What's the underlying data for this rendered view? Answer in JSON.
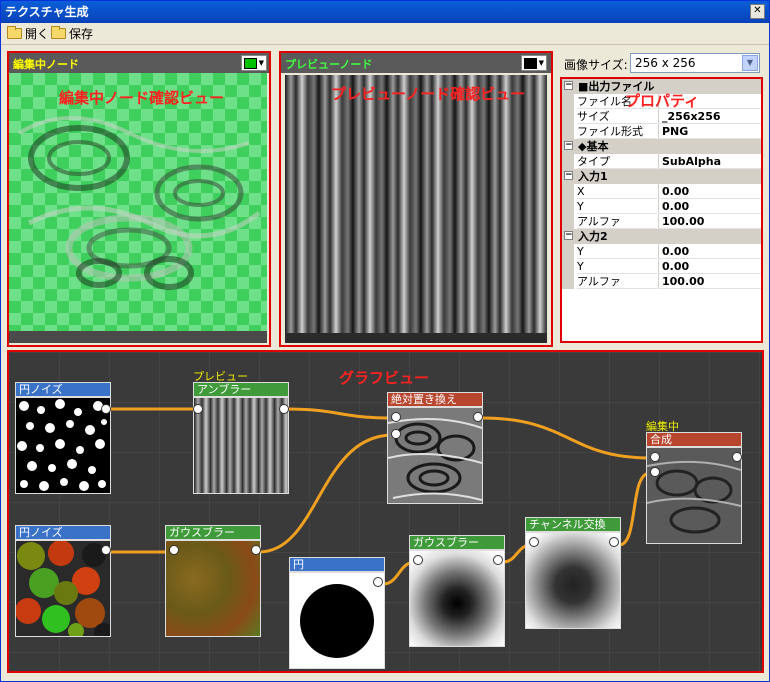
{
  "window": {
    "title": "テクスチャ生成",
    "close_glyph": "✕"
  },
  "toolbar": {
    "open_label": "開く",
    "save_label": "保存"
  },
  "edit_view": {
    "title": "編集中ノード",
    "overlay": "編集中ノード確認ビュー",
    "swatch_color": "#00c000"
  },
  "preview_view": {
    "title": "プレビューノード",
    "overlay": "プレビューノード確認ビュー",
    "swatch_color": "#000000"
  },
  "image_size": {
    "label": "画像サイズ:",
    "value": "256 x 256"
  },
  "properties": {
    "overlay": "プロパティ",
    "sections": [
      {
        "title": "■出力ファイル",
        "rows": [
          {
            "key": "ファイル名",
            "value": ""
          },
          {
            "key": "サイズ",
            "value": "_256x256"
          },
          {
            "key": "ファイル形式",
            "value": "PNG"
          }
        ]
      },
      {
        "title": "◆基本",
        "rows": [
          {
            "key": "タイプ",
            "value": "SubAlpha"
          }
        ]
      },
      {
        "title": "入力1",
        "rows": [
          {
            "key": "X",
            "value": "0.00"
          },
          {
            "key": "Y",
            "value": "0.00"
          },
          {
            "key": "アルファ",
            "value": "100.00"
          }
        ]
      },
      {
        "title": "入力2",
        "rows": [
          {
            "key": "Y",
            "value": "0.00"
          },
          {
            "key": "Y",
            "value": "0.00"
          },
          {
            "key": "アルファ",
            "value": "100.00"
          }
        ]
      }
    ]
  },
  "graph": {
    "overlay": "グラフビュー",
    "nodes": [
      {
        "label": "円ノイズ",
        "tag": ""
      },
      {
        "label": "アンブラー",
        "tag": "プレビュー"
      },
      {
        "label": "絶対置き換え",
        "tag": ""
      },
      {
        "label": "合成",
        "tag": "編集中"
      },
      {
        "label": "円ノイズ",
        "tag": ""
      },
      {
        "label": "ガウスブラー",
        "tag": ""
      },
      {
        "label": "円",
        "tag": ""
      },
      {
        "label": "ガウスブラー",
        "tag": ""
      },
      {
        "label": "チャンネル交換",
        "tag": ""
      }
    ],
    "colors": {
      "generator": "#3a72c8",
      "filter": "#3f9a3a",
      "combiner": "#b8452e",
      "wire": "#f0a020"
    }
  }
}
